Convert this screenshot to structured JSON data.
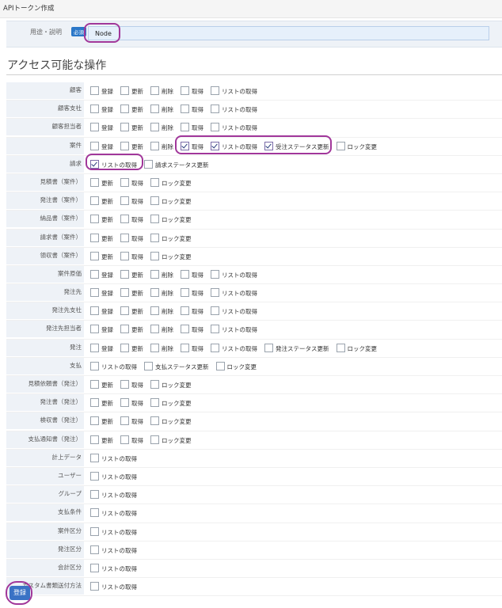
{
  "header": {
    "title": "APIトークン作成"
  },
  "purpose": {
    "label": "用途・説明",
    "required": "必須",
    "value": "Node"
  },
  "section": {
    "title": "アクセス可能な操作"
  },
  "submit_label": "登録",
  "rows": [
    {
      "label": "顧客",
      "options": [
        {
          "text": "登録",
          "checked": false
        },
        {
          "text": "更新",
          "checked": false
        },
        {
          "text": "削除",
          "checked": false
        },
        {
          "text": "取得",
          "checked": false
        },
        {
          "text": "リストの取得",
          "checked": false
        }
      ]
    },
    {
      "label": "顧客支社",
      "options": [
        {
          "text": "登録",
          "checked": false
        },
        {
          "text": "更新",
          "checked": false
        },
        {
          "text": "削除",
          "checked": false
        },
        {
          "text": "取得",
          "checked": false
        },
        {
          "text": "リストの取得",
          "checked": false
        }
      ]
    },
    {
      "label": "顧客担当者",
      "options": [
        {
          "text": "登録",
          "checked": false
        },
        {
          "text": "更新",
          "checked": false
        },
        {
          "text": "削除",
          "checked": false
        },
        {
          "text": "取得",
          "checked": false
        },
        {
          "text": "リストの取得",
          "checked": false
        }
      ]
    },
    {
      "label": "案件",
      "options": [
        {
          "text": "登録",
          "checked": false
        },
        {
          "text": "更新",
          "checked": false
        },
        {
          "text": "削除",
          "checked": false
        },
        {
          "text": "取得",
          "checked": true
        },
        {
          "text": "リストの取得",
          "checked": true
        },
        {
          "text": "受注ステータス更新",
          "checked": true
        },
        {
          "text": "ロック変更",
          "checked": false
        }
      ]
    },
    {
      "label": "請求",
      "options": [
        {
          "text": "リストの取得",
          "checked": true
        },
        {
          "text": "請求ステータス更新",
          "checked": false
        }
      ]
    },
    {
      "label": "見積書（案件）",
      "options": [
        {
          "text": "更新",
          "checked": false
        },
        {
          "text": "取得",
          "checked": false
        },
        {
          "text": "ロック変更",
          "checked": false
        }
      ]
    },
    {
      "label": "発注書（案件）",
      "options": [
        {
          "text": "更新",
          "checked": false
        },
        {
          "text": "取得",
          "checked": false
        },
        {
          "text": "ロック変更",
          "checked": false
        }
      ]
    },
    {
      "label": "納品書（案件）",
      "options": [
        {
          "text": "更新",
          "checked": false
        },
        {
          "text": "取得",
          "checked": false
        },
        {
          "text": "ロック変更",
          "checked": false
        }
      ]
    },
    {
      "label": "請求書（案件）",
      "options": [
        {
          "text": "更新",
          "checked": false
        },
        {
          "text": "取得",
          "checked": false
        },
        {
          "text": "ロック変更",
          "checked": false
        }
      ]
    },
    {
      "label": "領収書（案件）",
      "options": [
        {
          "text": "更新",
          "checked": false
        },
        {
          "text": "取得",
          "checked": false
        },
        {
          "text": "ロック変更",
          "checked": false
        }
      ]
    },
    {
      "label": "案件原価",
      "options": [
        {
          "text": "登録",
          "checked": false
        },
        {
          "text": "更新",
          "checked": false
        },
        {
          "text": "削除",
          "checked": false
        },
        {
          "text": "取得",
          "checked": false
        },
        {
          "text": "リストの取得",
          "checked": false
        }
      ]
    },
    {
      "label": "発注先",
      "options": [
        {
          "text": "登録",
          "checked": false
        },
        {
          "text": "更新",
          "checked": false
        },
        {
          "text": "削除",
          "checked": false
        },
        {
          "text": "取得",
          "checked": false
        },
        {
          "text": "リストの取得",
          "checked": false
        }
      ]
    },
    {
      "label": "発注先支社",
      "options": [
        {
          "text": "登録",
          "checked": false
        },
        {
          "text": "更新",
          "checked": false
        },
        {
          "text": "削除",
          "checked": false
        },
        {
          "text": "取得",
          "checked": false
        },
        {
          "text": "リストの取得",
          "checked": false
        }
      ]
    },
    {
      "label": "発注先担当者",
      "options": [
        {
          "text": "登録",
          "checked": false
        },
        {
          "text": "更新",
          "checked": false
        },
        {
          "text": "削除",
          "checked": false
        },
        {
          "text": "取得",
          "checked": false
        },
        {
          "text": "リストの取得",
          "checked": false
        }
      ]
    },
    {
      "label": "発注",
      "options": [
        {
          "text": "登録",
          "checked": false
        },
        {
          "text": "更新",
          "checked": false
        },
        {
          "text": "削除",
          "checked": false
        },
        {
          "text": "取得",
          "checked": false
        },
        {
          "text": "リストの取得",
          "checked": false
        },
        {
          "text": "発注ステータス更新",
          "checked": false
        },
        {
          "text": "ロック変更",
          "checked": false
        }
      ]
    },
    {
      "label": "支払",
      "options": [
        {
          "text": "リストの取得",
          "checked": false
        },
        {
          "text": "支払ステータス更新",
          "checked": false
        },
        {
          "text": "ロック変更",
          "checked": false
        }
      ]
    },
    {
      "label": "見積依頼書（発注）",
      "options": [
        {
          "text": "更新",
          "checked": false
        },
        {
          "text": "取得",
          "checked": false
        },
        {
          "text": "ロック変更",
          "checked": false
        }
      ]
    },
    {
      "label": "発注書（発注）",
      "options": [
        {
          "text": "更新",
          "checked": false
        },
        {
          "text": "取得",
          "checked": false
        },
        {
          "text": "ロック変更",
          "checked": false
        }
      ]
    },
    {
      "label": "検収書（発注）",
      "options": [
        {
          "text": "更新",
          "checked": false
        },
        {
          "text": "取得",
          "checked": false
        },
        {
          "text": "ロック変更",
          "checked": false
        }
      ]
    },
    {
      "label": "支払通知書（発注）",
      "options": [
        {
          "text": "更新",
          "checked": false
        },
        {
          "text": "取得",
          "checked": false
        },
        {
          "text": "ロック変更",
          "checked": false
        }
      ]
    },
    {
      "label": "計上データ",
      "options": [
        {
          "text": "リストの取得",
          "checked": false
        }
      ]
    },
    {
      "label": "ユーザー",
      "options": [
        {
          "text": "リストの取得",
          "checked": false
        }
      ]
    },
    {
      "label": "グループ",
      "options": [
        {
          "text": "リストの取得",
          "checked": false
        }
      ]
    },
    {
      "label": "支払条件",
      "options": [
        {
          "text": "リストの取得",
          "checked": false
        }
      ]
    },
    {
      "label": "案件区分",
      "options": [
        {
          "text": "リストの取得",
          "checked": false
        }
      ]
    },
    {
      "label": "発注区分",
      "options": [
        {
          "text": "リストの取得",
          "checked": false
        }
      ]
    },
    {
      "label": "会計区分",
      "options": [
        {
          "text": "リストの取得",
          "checked": false
        }
      ]
    },
    {
      "label": "カスタム書類送付方法",
      "options": [
        {
          "text": "リストの取得",
          "checked": false
        }
      ]
    }
  ]
}
